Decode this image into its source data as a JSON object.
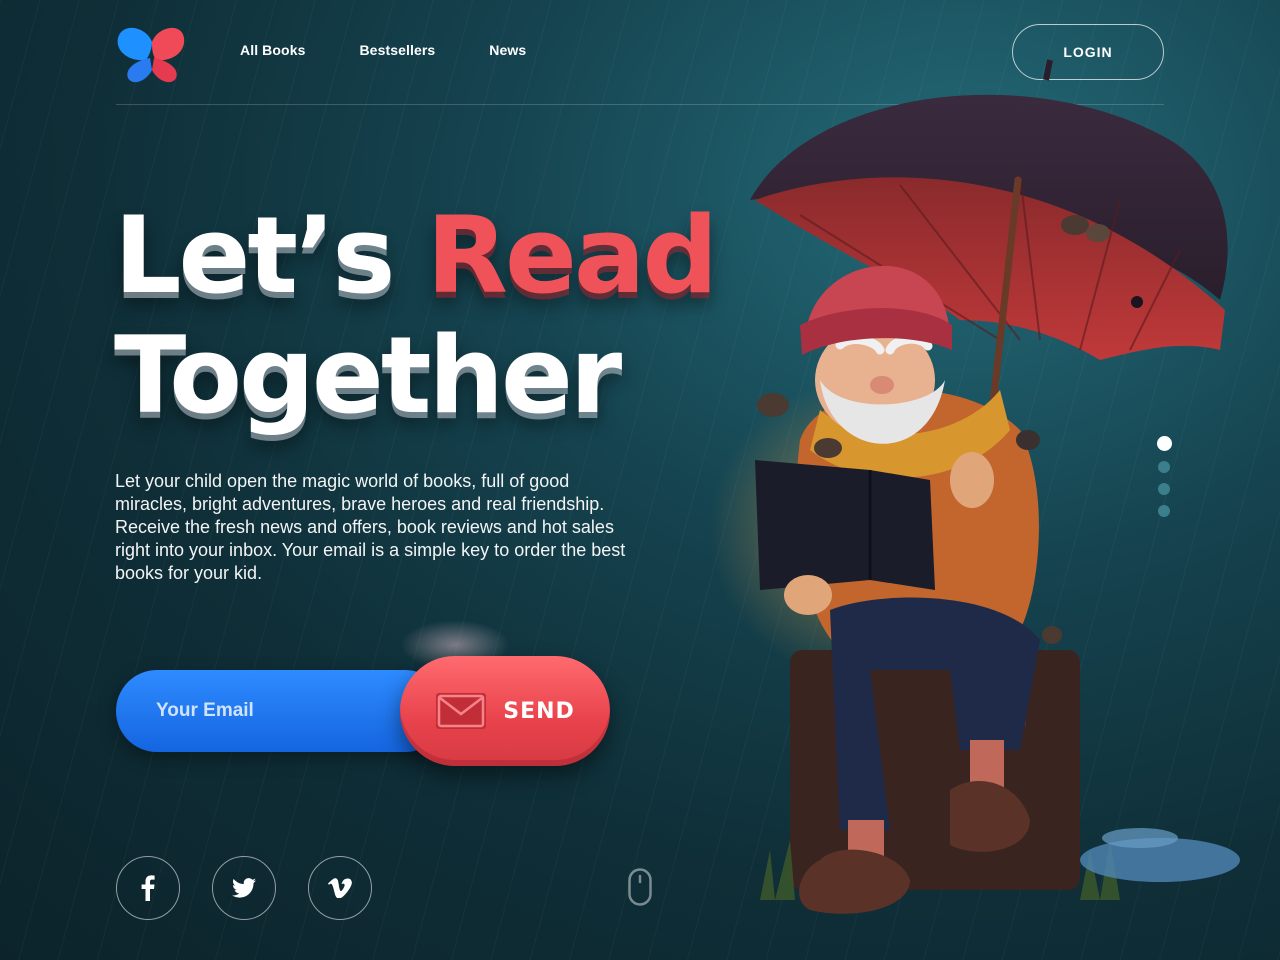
{
  "nav": {
    "items": [
      "All Books",
      "Bestsellers",
      "News"
    ],
    "login_label": "LOGIN"
  },
  "hero": {
    "headline_part1": "Let’s",
    "headline_highlight": "Read",
    "headline_line2": "Together",
    "description": "Let your child open the magic world of books, full of good miracles, bright adventures, brave heroes and real friendship. Receive the fresh news and offers, book reviews and hot sales right into your inbox. Your email is a simple key to order the best books for your kid."
  },
  "form": {
    "email_placeholder": "Your Email",
    "send_label": "SEND"
  },
  "social": {
    "icons": [
      {
        "name": "facebook-icon",
        "glyph": "f"
      },
      {
        "name": "twitter-icon",
        "glyph": "🐦"
      },
      {
        "name": "vimeo-icon",
        "glyph": "v"
      }
    ]
  },
  "slider": {
    "total": 4,
    "active_index": 0
  },
  "colors": {
    "accent_red": "#f0525a",
    "accent_blue": "#1e77f0",
    "background": "#15434f"
  }
}
